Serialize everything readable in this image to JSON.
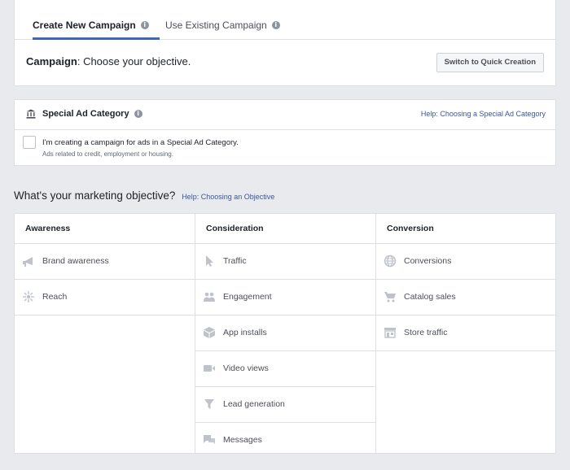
{
  "tabs": {
    "create_new": "Create New Campaign",
    "use_existing": "Use Existing Campaign",
    "info_glyph": "i"
  },
  "campaign": {
    "label": "Campaign",
    "text": ": Choose your objective.",
    "quick_button": "Switch to Quick Creation"
  },
  "special": {
    "title": "Special Ad Category",
    "help": "Help: Choosing a Special Ad Category",
    "checkbox_label": "I'm creating a campaign for ads in a Special Ad Category.",
    "checkbox_sub": "Ads related to credit, employment or housing."
  },
  "objective": {
    "heading": "What's your marketing objective?",
    "help": "Help: Choosing an Objective",
    "columns": [
      {
        "title": "Awareness",
        "items": [
          "Brand awareness",
          "Reach"
        ]
      },
      {
        "title": "Consideration",
        "items": [
          "Traffic",
          "Engagement",
          "App installs",
          "Video views",
          "Lead generation",
          "Messages"
        ]
      },
      {
        "title": "Conversion",
        "items": [
          "Conversions",
          "Catalog sales",
          "Store traffic"
        ]
      }
    ]
  },
  "colors": {
    "accent": "#4267b2",
    "link": "#385898",
    "icon_gray": "#bec3c9"
  }
}
